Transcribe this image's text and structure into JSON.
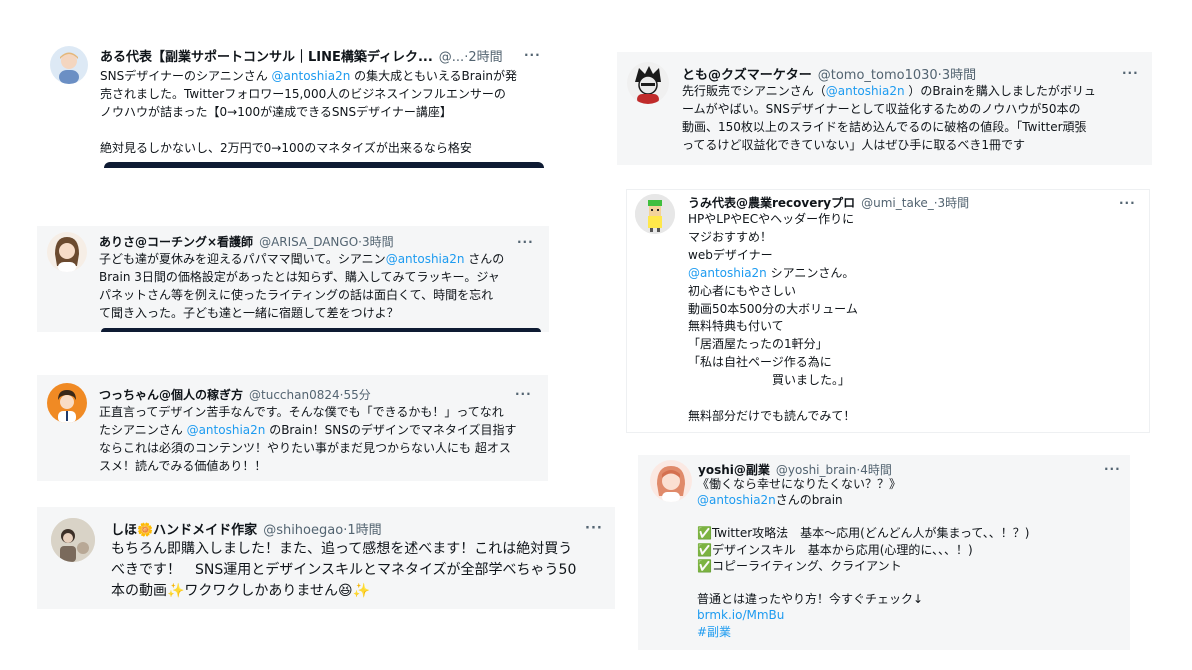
{
  "tweets": [
    {
      "name": "ある代表【副業サポートコンサル｜LINE構築ディレク...",
      "handle": "@...",
      "time": "2時間",
      "more": "···",
      "t1": "SNSデザイナーのシアニンさん ",
      "mention": "@antoshia2n",
      "t2": " の集大成ともいえるBrainが発\n売されました。Twitterフォロワー15,000人のビジネスインフルエンサーの\nノウハウが詰まった【0→100が達成できるSNSデザイナー講座】\n\n絶対見るしかないし、2万円で0→100のマネタイズが出来るなら格安"
    },
    {
      "name": "ありさ@コーチング×看護師",
      "handle": "@ARISA_DANGO",
      "time": "3時間",
      "more": "···",
      "t1": "子ども達が夏休みを迎えるパパママ聞いて。シアニン",
      "mention": "@antoshia2n",
      "t2": " さんの\nBrain 3日間の価格設定があったとは知らず、購入してみてラッキー。ジャ\nパネットさん等を例えに使ったライティングの話は面白くて、時間を忘れ\nて聞き入った。子ども達と一緒に宿題して差をつけよ？"
    },
    {
      "name": "つっちゃん@個人の稼ぎ方",
      "handle": "@tucchan0824",
      "time": "55分",
      "more": "···",
      "t1": "正直言ってデザイン苦手なんです。そんな僕でも「できるかも！」ってなれ\nたシアニンさん ",
      "mention": "@antoshia2n",
      "t2": " のBrain！SNSのデザインでマネタイズ目指す\nならこれは必須のコンテンツ！やりたい事がまだ見つからない人にも 超オス\nスメ！読んでみる価値あり！！"
    },
    {
      "name": "しほ🌼ハンドメイド作家",
      "handle": "@shihoegao",
      "time": "1時間",
      "more": "···",
      "t1": "もちろん即購入しました！また、追って感想を述べます！これは絶対買う\nべきです！　SNS運用とデザインスキルとマネタイズが全部学べちゃう50\n本の動画✨ワクワクしかありません😆✨",
      "mention": "",
      "t2": ""
    },
    {
      "name": "とも@クズマーケター",
      "handle": "@tomo_tomo1030",
      "time": "3時間",
      "more": "···",
      "t1": "先行販売でシアニンさん（",
      "mention": "@antoshia2n",
      "t2": " ）のBrainを購入しましたがボリュ\nームがやばい。SNSデザイナーとして収益化するためのノウハウが50本の\n動画、150枚以上のスライドを詰め込んでるのに破格の値段。「Twitter頑張\nってるけど収益化できていない」人はぜひ手に取るべき1冊です"
    },
    {
      "name": "うみ代表@農業recoveryプロ",
      "handle": "@umi_take_",
      "time": "3時間",
      "more": "···",
      "t1": "HPやLPやECやヘッダー作りに\nマジおすすめ！\nwebデザイナー\n",
      "mention": "@antoshia2n",
      "t2": " シアニンさん。\n初心者にもやさしい\n動画50本500分の大ボリューム\n無料特典も付いて\n「居酒屋たったの1軒分」\n「私は自社ページ作る為に\n　　　　　　　買いました。」\n\n無料部分だけでも読んでみて！"
    },
    {
      "name": "yoshi@副業",
      "handle": "@yoshi_brain",
      "time": "4時間",
      "more": "···",
      "t1": "《働くなら幸せになりたくない？？》\n",
      "mention": "@antoshia2n",
      "t2": "さんのbrain\n\n✅Twitter攻略法　基本〜応用(どんどん人が集まって、、！？)\n✅デザインスキル　基本から応用(心理的に、、、！)\n✅コピーライティング、クライアント\n\n普通とは違ったやり方！今すぐチェック↓\n",
      "link": "brmk.io/MmBu",
      "hashtag": "#副業"
    }
  ],
  "colors": {
    "link": "#1d9bf0",
    "meta": "#536471",
    "text": "#0f1419",
    "card_gray": "#f5f6f7"
  },
  "sep": " · "
}
